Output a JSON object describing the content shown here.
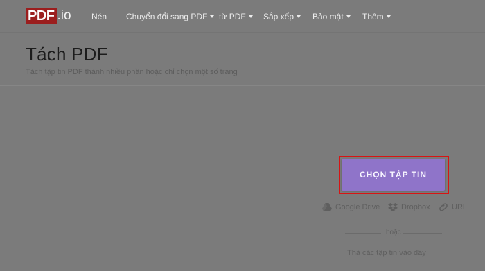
{
  "brand": {
    "logo_box": "PDF",
    "logo_suffix": ".io"
  },
  "nav": {
    "items": [
      {
        "label": "Nén",
        "has_caret": false
      },
      {
        "label": "Chuyển đổi sang PDF",
        "has_caret": true
      },
      {
        "label": "từ PDF",
        "has_caret": true
      },
      {
        "label": "Sắp xếp",
        "has_caret": true
      },
      {
        "label": "Bảo mật",
        "has_caret": true
      },
      {
        "label": "Thêm",
        "has_caret": true
      }
    ]
  },
  "header": {
    "title": "Tách PDF",
    "subtitle": "Tách tập tin PDF thành nhiều phần hoặc chỉ chọn một số trang"
  },
  "upload": {
    "button_label": "CHỌN TẬP TIN",
    "sources": [
      {
        "label": "Google Drive",
        "icon": "google-drive-icon"
      },
      {
        "label": "Dropbox",
        "icon": "dropbox-icon"
      },
      {
        "label": "URL",
        "icon": "link-icon"
      }
    ],
    "or_label": "hoặc",
    "drop_hint": "Thả các tập tin vào đây"
  },
  "colors": {
    "logo_red": "#9b1e1e",
    "button_purple": "#8f74c9",
    "highlight_red": "#d71414",
    "overlay_gray": "#7b7b7b"
  }
}
